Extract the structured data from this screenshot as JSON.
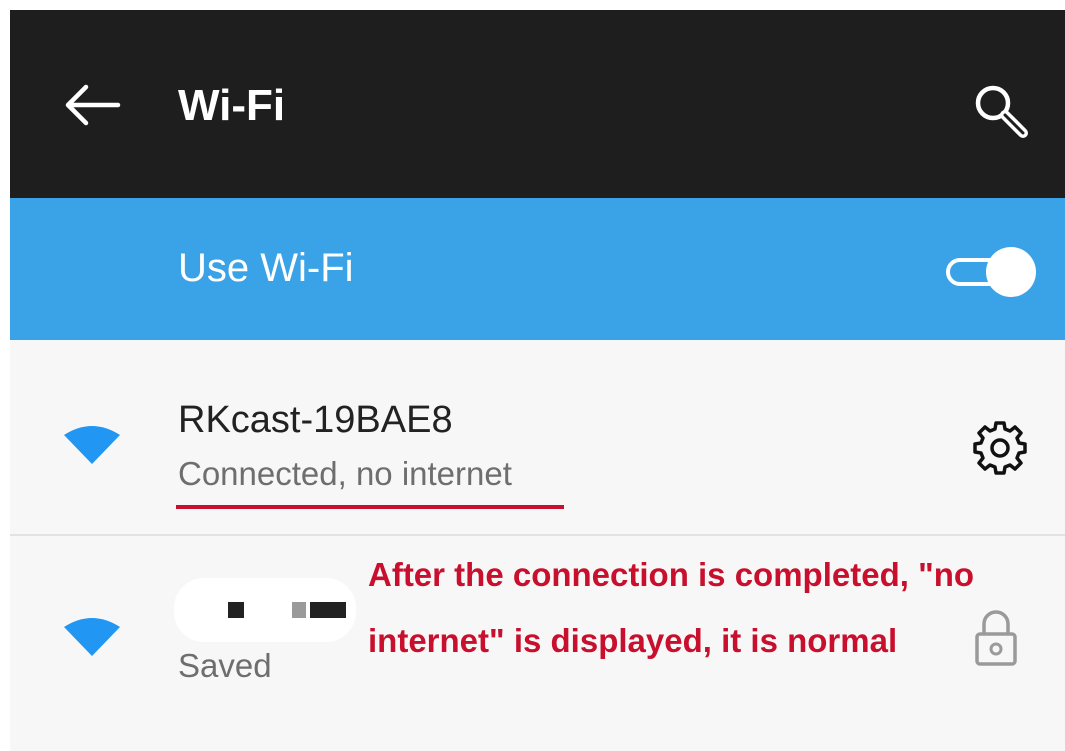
{
  "toolbar": {
    "back_icon": "arrow-left-icon",
    "title": "Wi-Fi",
    "search_icon": "search-icon"
  },
  "master_switch": {
    "label": "Use Wi-Fi",
    "state": "on"
  },
  "networks": [
    {
      "name": "RKcast-19BAE8",
      "status": "Connected, no internet",
      "signal_icon": "wifi-signal-icon",
      "action_icon": "gear-icon"
    },
    {
      "name": "",
      "status": "Saved",
      "signal_icon": "wifi-signal-icon",
      "action_icon": "lock-icon"
    }
  ],
  "annotation": {
    "text": "After the connection is completed, \"no internet\" is displayed, it is normal",
    "color": "#c8102e"
  },
  "colors": {
    "toolbar_bg": "#1e1e1e",
    "accent": "#3aa3e8",
    "wifi_icon": "#2196f3"
  }
}
